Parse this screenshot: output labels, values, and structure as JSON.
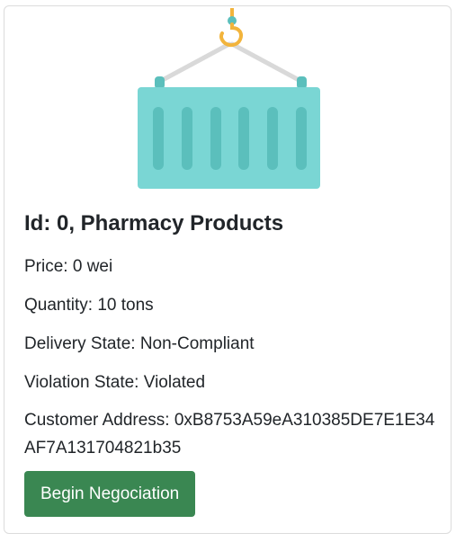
{
  "card": {
    "image_icon": "shipping-container-icon",
    "title": "Id: 0, Pharmacy Products",
    "price": "Price: 0 wei",
    "quantity": "Quantity: 10 tons",
    "delivery_state": "Delivery State: Non-Compliant",
    "violation_state": "Violation State: Violated",
    "customer_address": "Customer Address: 0xB8753A59eA310385DE7E1E34AF7A131704821b35",
    "action_button_label": "Begin Negociation"
  },
  "colors": {
    "container": "#7ad6d4",
    "container_ribs": "#5bbfbc",
    "hook": "#f2b43c",
    "cables": "#d9d9d9",
    "button": "#3a8752"
  }
}
